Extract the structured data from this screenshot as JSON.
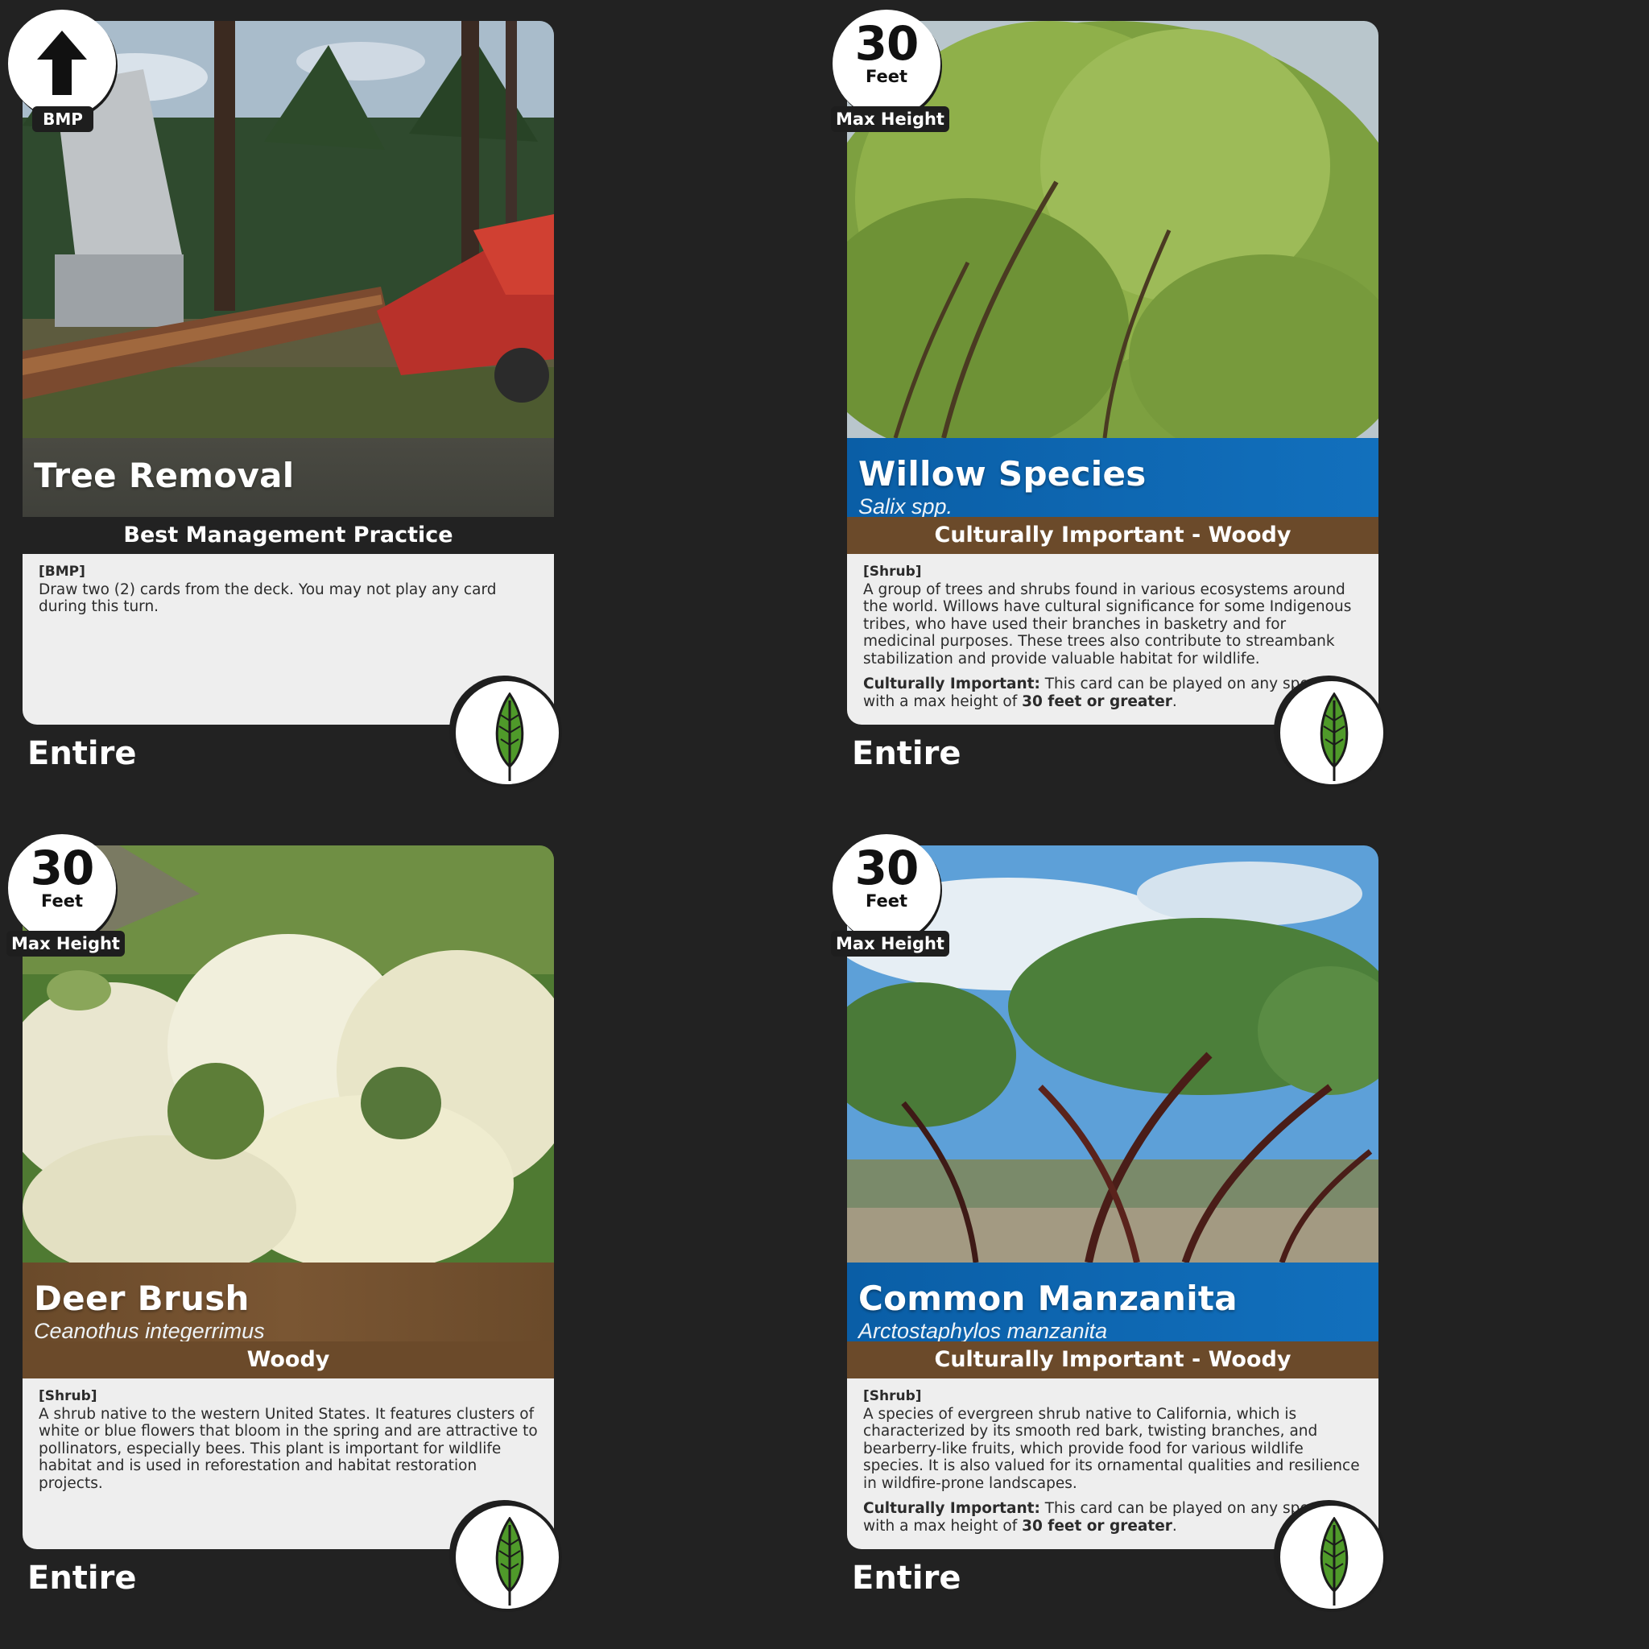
{
  "cards": [
    {
      "corner": {
        "value": "",
        "unit": "",
        "label": "BMP",
        "icon": "up-arrow-icon"
      },
      "title": "Tree Removal",
      "subtitle": "",
      "category": "Best Management Practice",
      "tag": "[BMP]",
      "description": "Draw two (2) cards from the deck. You may not play any card during this turn.",
      "note": {
        "lead": "",
        "text": "",
        "strong": "",
        "end": ""
      },
      "size": "Entire",
      "badge_icon": "leaf-icon",
      "band_color": "#454640"
    },
    {
      "corner": {
        "value": "30",
        "unit": "Feet",
        "label": "Max Height"
      },
      "title": "Willow Species",
      "subtitle": "Salix spp.",
      "category": "Culturally Important - Woody",
      "tag": "[Shrub]",
      "description": "A group of trees and shrubs found in various ecosystems around the world. Willows have cultural significance for some Indigenous tribes, who have used their branches in basketry and for medicinal purposes. These trees also contribute to streambank stabilization and provide valuable habitat for wildlife.",
      "note": {
        "lead": "Culturally Important:",
        "text": " This card can be played on any species with a max height of ",
        "strong": "30 feet or greater",
        "end": "."
      },
      "size": "Entire",
      "badge_icon": "leaf-icon",
      "band_color": "#0d65b0"
    },
    {
      "corner": {
        "value": "30",
        "unit": "Feet",
        "label": "Max Height"
      },
      "title": "Deer Brush",
      "subtitle": "Ceanothus integerrimus",
      "category": "Woody",
      "tag": "[Shrub]",
      "description": "A shrub native to the western United States. It features clusters of white or blue flowers that bloom in the spring and are attractive to pollinators, especially bees. This plant is important for wildlife habitat and is used in reforestation and habitat restoration projects.",
      "note": {
        "lead": "",
        "text": "",
        "strong": "",
        "end": ""
      },
      "size": "Entire",
      "badge_icon": "leaf-icon",
      "band_color": "#6f4d2c"
    },
    {
      "corner": {
        "value": "30",
        "unit": "Feet",
        "label": "Max Height"
      },
      "title": "Common Manzanita",
      "subtitle": "Arctostaphylos manzanita",
      "category": "Culturally Important - Woody",
      "tag": "[Shrub]",
      "description": "A species of evergreen shrub native to California, which is characterized by its smooth red bark, twisting branches, and bearberry-like fruits, which provide food for various wildlife species. It is also valued for its ornamental qualities and resilience in wildfire-prone landscapes.",
      "note": {
        "lead": "Culturally Important:",
        "text": " This card can be played on any species with a max height of ",
        "strong": "30 feet or greater",
        "end": "."
      },
      "size": "Entire",
      "badge_icon": "leaf-icon",
      "band_color": "#0d65b0"
    }
  ]
}
